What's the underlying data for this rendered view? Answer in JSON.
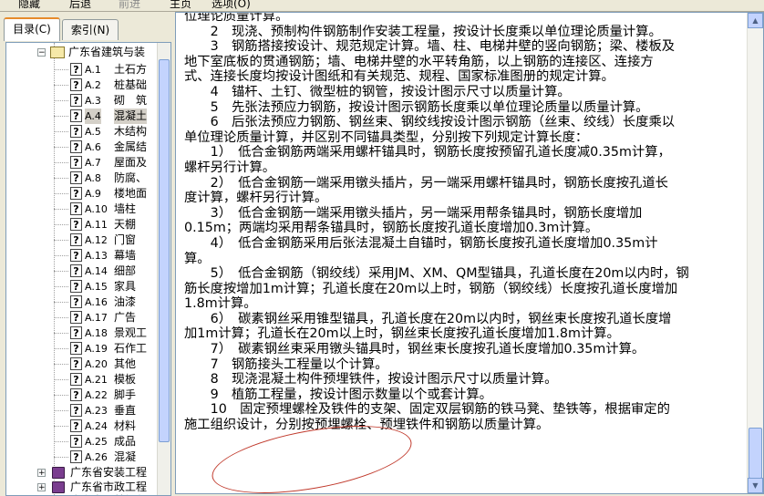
{
  "toolbar": {
    "hide": "隐藏",
    "back": "后退",
    "forward": "前进",
    "home": "主页",
    "options": "选项(O)"
  },
  "tabs": {
    "contents": "目录(C)",
    "index": "索引(N)"
  },
  "tree": {
    "root": "广东省建筑与装",
    "items": [
      {
        "code": "A.1",
        "name": "土石方"
      },
      {
        "code": "A.2",
        "name": "桩基础"
      },
      {
        "code": "A.3",
        "name": "砌　筑"
      },
      {
        "code": "A.4",
        "name": "混凝土"
      },
      {
        "code": "A.5",
        "name": "木结构"
      },
      {
        "code": "A.6",
        "name": "金属结"
      },
      {
        "code": "A.7",
        "name": "屋面及"
      },
      {
        "code": "A.8",
        "name": "防腐、"
      },
      {
        "code": "A.9",
        "name": "楼地面"
      },
      {
        "code": "A.10",
        "name": "墙柱"
      },
      {
        "code": "A.11",
        "name": "天棚"
      },
      {
        "code": "A.12",
        "name": "门窗"
      },
      {
        "code": "A.13",
        "name": "幕墙"
      },
      {
        "code": "A.14",
        "name": "细部"
      },
      {
        "code": "A.15",
        "name": "家具"
      },
      {
        "code": "A.16",
        "name": "油漆"
      },
      {
        "code": "A.17",
        "name": "广告"
      },
      {
        "code": "A.18",
        "name": "景观工"
      },
      {
        "code": "A.19",
        "name": "石作工"
      },
      {
        "code": "A.20",
        "name": "其他"
      },
      {
        "code": "A.21",
        "name": "模板"
      },
      {
        "code": "A.22",
        "name": "脚手"
      },
      {
        "code": "A.23",
        "name": "垂直"
      },
      {
        "code": "A.24",
        "name": "材料"
      },
      {
        "code": "A.25",
        "name": "成品"
      },
      {
        "code": "A.26",
        "name": "混凝"
      }
    ],
    "other_books": [
      "广东省安装工程",
      "广东省市政工程",
      "广东省园林绿化"
    ]
  },
  "content": {
    "lines": [
      "位理论质量计算。",
      "　　2　现浇、预制构件钢筋制作安装工程量，按设计长度乘以单位理论质量计算。",
      "　　3　钢筋搭接按设计、规范规定计算。墙、柱、电梯井壁的竖向钢筋；梁、楼板及",
      "地下室底板的贯通钢筋；墙、电梯井壁的水平转角筋，以上钢筋的连接区、连接方",
      "式、连接长度均按设计图纸和有关规范、规程、国家标准图册的规定计算。",
      "　　4　锚杆、土钉、微型桩的钢管，按设计图示尺寸以质量计算。",
      "　　5　先张法预应力钢筋，按设计图示钢筋长度乘以单位理论质量以质量计算。",
      "　　6　后张法预应力钢筋、钢丝束、钢绞线按设计图示钢筋（丝束、绞线）长度乘以",
      "单位理论质量计算，并区别不同锚具类型，分别按下列规定计算长度：",
      "　　1）　低合金钢筋两端采用螺杆锚具时，钢筋长度按预留孔道长度减0.35m计算，",
      "螺杆另行计算。",
      "　　2）　低合金钢筋一端采用镦头插片，另一端采用螺杆锚具时，钢筋长度按孔道长",
      "度计算，螺杆另行计算。",
      "　　3）　低合金钢筋一端采用镦头插片，另一端采用帮条锚具时，钢筋长度增加",
      "0.15m；两端均采用帮条锚具时，钢筋长度按孔道长度增加0.3m计算。",
      "　　4）　低合金钢筋采用后张法混凝土自锚时，钢筋长度按孔道长度增加0.35m计",
      "算。",
      "　　5）　低合金钢筋（钢绞线）采用JM、XM、QM型锚具，孔道长度在20m以内时，钢",
      "筋长度按增加1m计算；孔道长度在20m以上时，钢筋（钢绞线）长度按孔道长度增加",
      "1.8m计算。",
      "　　6）　碳素钢丝采用锥型锚具，孔道长度在20m以内时，钢丝束长度按孔道长度增",
      "加1m计算；孔道长在20m以上时，钢丝束长度按孔道长度增加1.8m计算。",
      "　　7）　碳素钢丝束采用镦头锚具时，钢丝束长度按孔道长度增加0.35m计算。",
      "　　7　钢筋接头工程量以个计算。",
      "　　8　现浇混凝土构件预埋铁件，按设计图示尺寸以质量计算。",
      "　　9　植筋工程量，按设计图示数量以个或套计算。",
      "　　10　固定预埋螺栓及铁件的支架、固定双层钢筋的铁马凳、垫铁等，根据审定的",
      "施工组织设计，分别按预埋螺栓、预埋铁件和钢筋以质量计算。"
    ]
  },
  "colors": {
    "annotation_ellipse": "#c0392b",
    "selected_row": "#d4d0c8"
  }
}
